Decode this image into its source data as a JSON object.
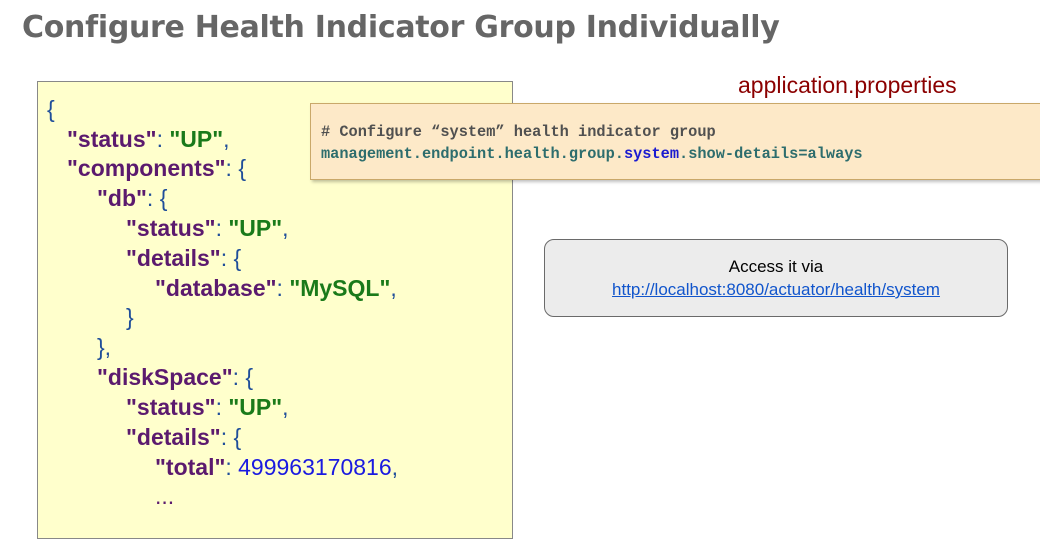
{
  "title": "Configure Health Indicator Group Individually",
  "json_response": {
    "open_brace": "{",
    "status_key": "\"status\"",
    "status_value": "\"UP\"",
    "components_key": "\"components\"",
    "db_key": "\"db\"",
    "db_status_key": "\"status\"",
    "db_status_value": "\"UP\"",
    "db_details_key": "\"details\"",
    "database_key": "\"database\"",
    "database_value": "\"MySQL\"",
    "db_details_close": "}",
    "db_close": "},",
    "diskspace_key": "\"diskSpace\"",
    "disk_status_key": "\"status\"",
    "disk_status_value": "\"UP\"",
    "disk_details_key": "\"details\"",
    "total_key": "\"total\"",
    "total_value": "499963170816",
    "ellipsis": "..."
  },
  "properties_file": {
    "label": "application.properties",
    "comment": "# Configure “system” health indicator group",
    "property_prefix": "management.endpoint.health.group.",
    "property_group": "system",
    "property_suffix": ".show-details=always"
  },
  "access": {
    "text": "Access it via",
    "url": "http://localhost:8080/actuator/health/system"
  }
}
